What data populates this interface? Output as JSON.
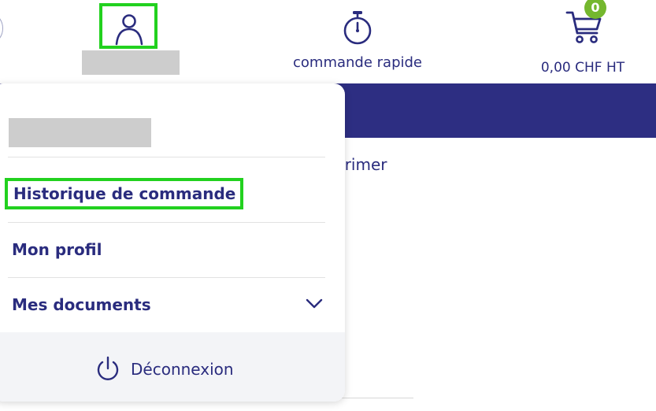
{
  "header": {
    "account": {
      "icon": "user-icon"
    },
    "quick_order": {
      "label": "commande rapide",
      "icon": "stopwatch-icon"
    },
    "cart": {
      "count": "0",
      "total": "0,00 CHF HT",
      "icon": "cart-icon"
    }
  },
  "background": {
    "partial_text": "primer"
  },
  "account_menu": {
    "items": [
      {
        "label": "Historique de commande",
        "highlighted": true
      },
      {
        "label": "Mon profil"
      },
      {
        "label": "Mes documents",
        "icon": "chevron-down-icon"
      }
    ],
    "logout": {
      "label": "Déconnexion",
      "icon": "power-icon"
    }
  },
  "colors": {
    "primary": "#2a2c7e",
    "navbar": "#2d2e82",
    "badge": "#74b72e",
    "highlight": "#22d11f"
  }
}
